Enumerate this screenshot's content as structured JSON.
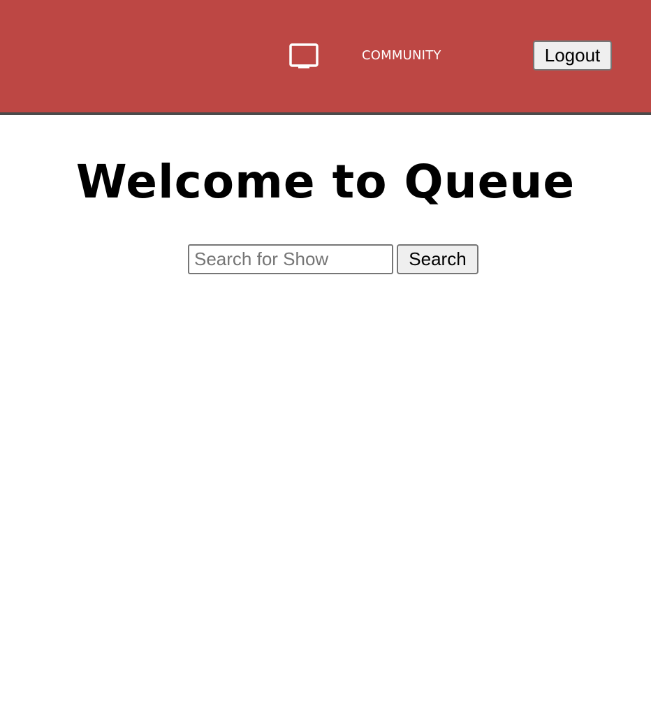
{
  "theme": {
    "navbar_bg": "#bd4744",
    "navbar_border": "#4a4a4a",
    "nav_text": "#ffffff"
  },
  "navbar": {
    "home_icon": "tv-icon",
    "community_label": "COMMUNITY",
    "logout_label": "Logout"
  },
  "main": {
    "title": "Welcome to Queue",
    "search": {
      "value": "",
      "placeholder": "Search for Show",
      "button_label": "Search"
    }
  }
}
